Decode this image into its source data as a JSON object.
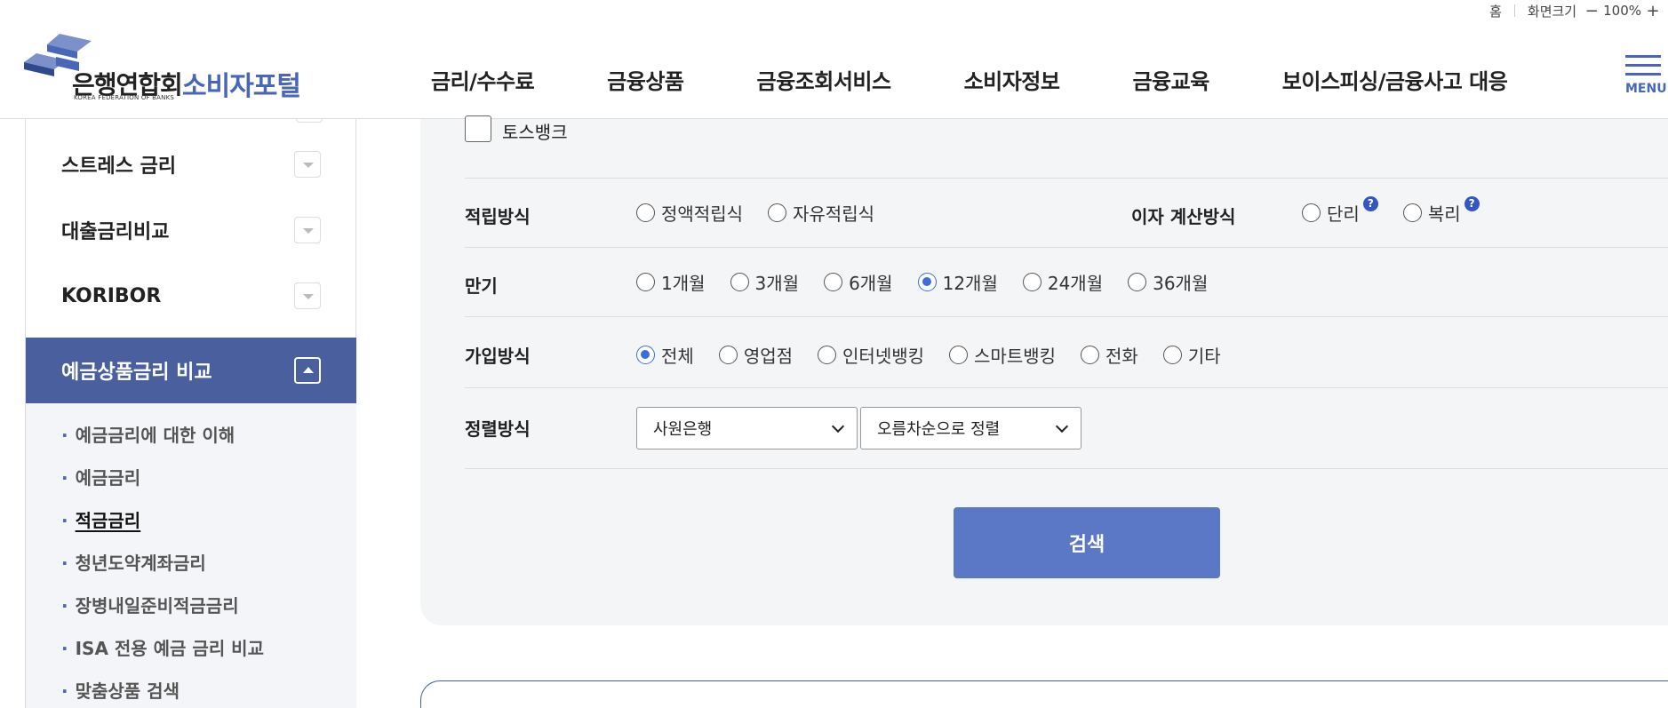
{
  "utility": {
    "home": "홈",
    "zoom_label": "화면크기",
    "zoom_minus": "−",
    "zoom_value": "100%",
    "zoom_plus": "+"
  },
  "logo": {
    "name": "은행연합회",
    "sub": "KOREA FEDERATION OF BANKS",
    "portal": "소비자포털",
    "colors": {
      "primary": "#4a66b8",
      "dark": "#2d4a8a"
    }
  },
  "gnb": [
    "금리/수수료",
    "금융상품",
    "금융조회서비스",
    "소비자정보",
    "금융교육",
    "보이스피싱/금융사고 대응"
  ],
  "menu_label": "MENU",
  "sidebar": {
    "items": [
      {
        "label": "스트레스 금리"
      },
      {
        "label": "대출금리비교"
      },
      {
        "label": "KORIBOR"
      },
      {
        "label": "예금상품금리 비교"
      }
    ],
    "sub_items": [
      "예금금리에 대한 이해",
      "예금금리",
      "적금금리",
      "청년도약계좌금리",
      "장병내일준비적금금리",
      "ISA 전용 예금 금리 비교",
      "맞춤상품 검색"
    ],
    "current_sub": "적금금리"
  },
  "form": {
    "bank_checkbox": {
      "label": "토스뱅크",
      "checked": false
    },
    "savings_method": {
      "label": "적립방식",
      "options": [
        "정액적립식",
        "자유적립식"
      ],
      "selected": null
    },
    "interest_calc": {
      "label": "이자 계산방식",
      "options": [
        "단리",
        "복리"
      ],
      "help": "?"
    },
    "term": {
      "label": "만기",
      "options": [
        "1개월",
        "3개월",
        "6개월",
        "12개월",
        "24개월",
        "36개월"
      ],
      "selected": "12개월"
    },
    "join_method": {
      "label": "가입방식",
      "options": [
        "전체",
        "영업점",
        "인터넷뱅킹",
        "스마트뱅킹",
        "전화",
        "기타"
      ],
      "selected": "전체"
    },
    "sort": {
      "label": "정렬방식",
      "select1": "사원은행",
      "select2": "오름차순으로 정렬"
    },
    "search_label": "검색"
  },
  "accent_color": "#3b6fd6"
}
